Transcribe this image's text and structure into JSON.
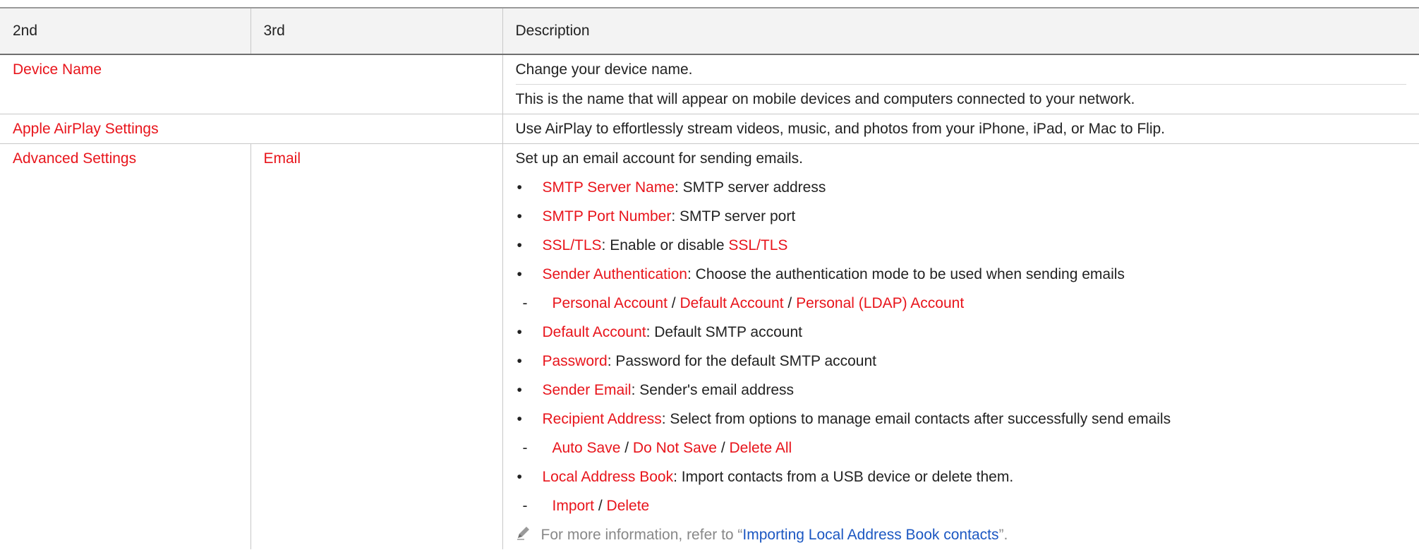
{
  "header": {
    "col1": "2nd",
    "col2": "3rd",
    "col3": "Description"
  },
  "rows": {
    "device_name": {
      "label": "Device Name",
      "desc1": "Change your device name.",
      "desc2": "This is the name that will appear on mobile devices and computers connected to your network."
    },
    "airplay": {
      "label": "Apple AirPlay Settings",
      "desc": "Use AirPlay to effortlessly stream videos, music, and photos from your iPhone, iPad, or Mac to Flip."
    },
    "advanced": {
      "label": "Advanced Settings",
      "sub": "Email",
      "intro": "Set up an email account for sending emails.",
      "smtp_name": {
        "term": "SMTP Server Name",
        "text": ": SMTP server address"
      },
      "smtp_port": {
        "term": "SMTP Port Number",
        "text": ": SMTP server port"
      },
      "ssl": {
        "term": "SSL/TLS",
        "text": ": Enable or disable ",
        "term2": "SSL/TLS"
      },
      "auth": {
        "term": "Sender Authentication",
        "text": ": Choose the authentication mode to be used when sending emails"
      },
      "auth_opts": {
        "a": "Personal Account",
        "b": "Default Account",
        "c": "Personal (LDAP) Account",
        "sep": " / "
      },
      "default_account": {
        "term": "Default Account",
        "text": ": Default SMTP account"
      },
      "password": {
        "term": "Password",
        "text": ": Password for the default SMTP account"
      },
      "sender_email": {
        "term": "Sender Email",
        "text": ": Sender's email address"
      },
      "recipient": {
        "term": "Recipient Address",
        "text": ": Select from options to manage email contacts after successfully send emails"
      },
      "recipient_opts": {
        "a": "Auto Save",
        "b": "Do Not Save",
        "c": "Delete All",
        "sep": " / "
      },
      "local_book": {
        "term": "Local Address Book",
        "text": ": Import contacts from a USB device or delete them."
      },
      "local_opts": {
        "a": "Import",
        "b": "Delete",
        "sep": " / "
      },
      "note": {
        "prefix": "For more information, refer to “",
        "link": "Importing Local Address Book contacts",
        "suffix": "”."
      }
    }
  },
  "colors": {
    "red": "#e8141b",
    "blue": "#1b57c2",
    "note": "#888888"
  }
}
